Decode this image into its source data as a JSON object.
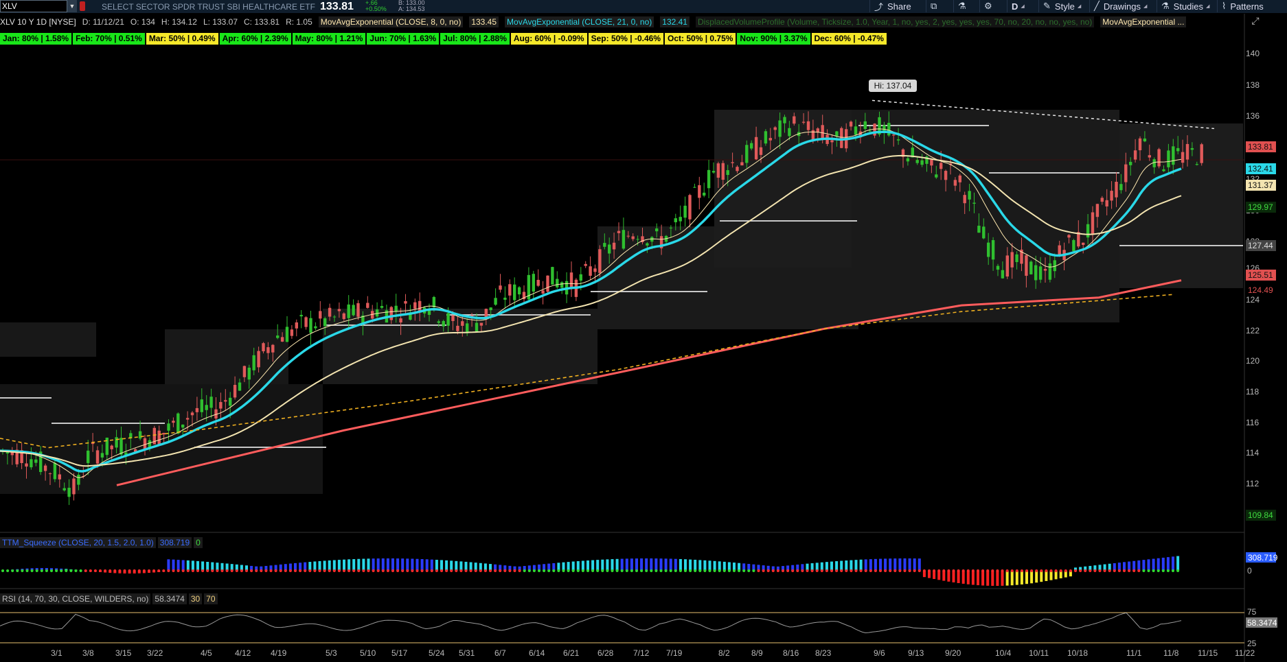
{
  "toolbar": {
    "symbol_value": "XLV",
    "instrument_name": "SELECT SECTOR SPDR TRUST SBI HEALTHCARE ETF",
    "last_price": "133.81",
    "change_abs": "+.66",
    "change_pct": "+0.50%",
    "bid": "B: 133.00",
    "ask": "A: 134.53",
    "share_label": "Share",
    "period_label": "D",
    "style_label": "Style",
    "drawings_label": "Drawings",
    "studies_label": "Studies",
    "patterns_label": "Patterns"
  },
  "ohlc_row": {
    "chart_title": "XLV 10 Y 1D [NYSE]",
    "date": "D: 11/12/21",
    "open": "O: 134",
    "high": "H: 134.12",
    "low": "L: 133.07",
    "close": "C: 133.81",
    "range": "R: 1.05",
    "studies": [
      {
        "label": "MovAvgExponential (CLOSE, 8, 0, no)",
        "value": "133.45",
        "color": "#ffe9b0"
      },
      {
        "label": "MovAvgExponential (CLOSE, 21, 0, no)",
        "value": "132.41",
        "color": "#2ad8e8"
      },
      {
        "label": "DisplacedVolumeProfile (Volume, Ticksize, 1.0, Year, 1, no, yes, 2, yes, yes, yes, 70, no, 20, no, no, yes, no)",
        "value": "",
        "color": "#2c6c2c"
      },
      {
        "label": "MovAvgExponential ...",
        "value": "",
        "color": "#ffe9b0"
      }
    ]
  },
  "seasonality": [
    {
      "label": "Jan: 80% | 1.58%",
      "color": "#19e619"
    },
    {
      "label": "Feb: 70% | 0.51%",
      "color": "#19e619"
    },
    {
      "label": "Mar: 50% | 0.49%",
      "color": "#f5e82a"
    },
    {
      "label": "Apr: 60% | 2.39%",
      "color": "#19e619"
    },
    {
      "label": "May: 80% | 1.21%",
      "color": "#19e619"
    },
    {
      "label": "Jun: 70% | 1.63%",
      "color": "#19e619"
    },
    {
      "label": "Jul: 80% | 2.88%",
      "color": "#19e619"
    },
    {
      "label": "Aug: 60% | -0.09%",
      "color": "#f5e82a"
    },
    {
      "label": "Sep: 50% | -0.46%",
      "color": "#f5e82a"
    },
    {
      "label": "Oct: 50% | 0.75%",
      "color": "#f5e82a"
    },
    {
      "label": "Nov: 90% | 3.37%",
      "color": "#19e619"
    },
    {
      "label": "Dec: 60% | -0.47%",
      "color": "#f5e82a"
    }
  ],
  "price_axis": {
    "ticks": [
      "140",
      "138",
      "136",
      "134",
      "132",
      "130",
      "128",
      "126",
      "124",
      "122",
      "120",
      "118",
      "116",
      "114",
      "112"
    ],
    "tags": [
      {
        "label": "133.81",
        "bg": "#e05050",
        "fg": "#111111",
        "price": 133.81
      },
      {
        "label": "132.41",
        "bg": "#2ad8e8",
        "fg": "#111111",
        "price": 132.41
      },
      {
        "label": "131.37",
        "bg": "#f3e4b0",
        "fg": "#111111",
        "price": 131.37
      },
      {
        "label": "129.97",
        "bg": "#0a2a0a",
        "fg": "#3fdc3f",
        "price": 129.97
      },
      {
        "label": "127.44",
        "bg": "#444444",
        "fg": "#dddddd",
        "price": 127.44
      },
      {
        "label": "125.51",
        "bg": "#e05050",
        "fg": "#111111",
        "price": 125.51
      },
      {
        "label": "124.49",
        "bg": "#000000",
        "fg": "#e05050",
        "price": 124.49
      },
      {
        "label": "109.84",
        "bg": "#0a2a0a",
        "fg": "#3fdc3f",
        "price": 109.84
      }
    ]
  },
  "date_axis": {
    "ticks": [
      "3/1",
      "3/8",
      "3/15",
      "3/22",
      "4/5",
      "4/12",
      "4/19",
      "5/3",
      "5/10",
      "5/17",
      "5/24",
      "5/31",
      "6/7",
      "6/14",
      "6/21",
      "6/28",
      "7/12",
      "7/19",
      "8/2",
      "8/9",
      "8/16",
      "8/23",
      "9/6",
      "9/13",
      "9/20",
      "10/4",
      "10/11",
      "10/18",
      "11/1",
      "11/8",
      "11/15",
      "11/22"
    ]
  },
  "hi_callout": "Hi: 137.04",
  "squeeze_panel": {
    "name": "TTM_Squeeze (CLOSE, 20, 1.5, 2.0, 1.0)",
    "value": "308.719",
    "zero": "0",
    "axis_tag": "308.719",
    "axis_zero": "0"
  },
  "rsi_panel": {
    "name": "RSI (14, 70, 30, CLOSE, WILDERS, no)",
    "value": "58.3474",
    "oversold": "30",
    "overbought": "70",
    "axis_75": "75",
    "axis_tag": "58.3474",
    "axis_25": "25"
  },
  "colors": {
    "up_candle": "#2fbf2f",
    "down_candle": "#e05a5a",
    "ema8": "#ffe9b0",
    "ema21": "#2ad8e8",
    "ema_slow": "#f3e4b0",
    "sma200": "#ff5c5c",
    "dotted_ma": "#f0b020"
  }
}
